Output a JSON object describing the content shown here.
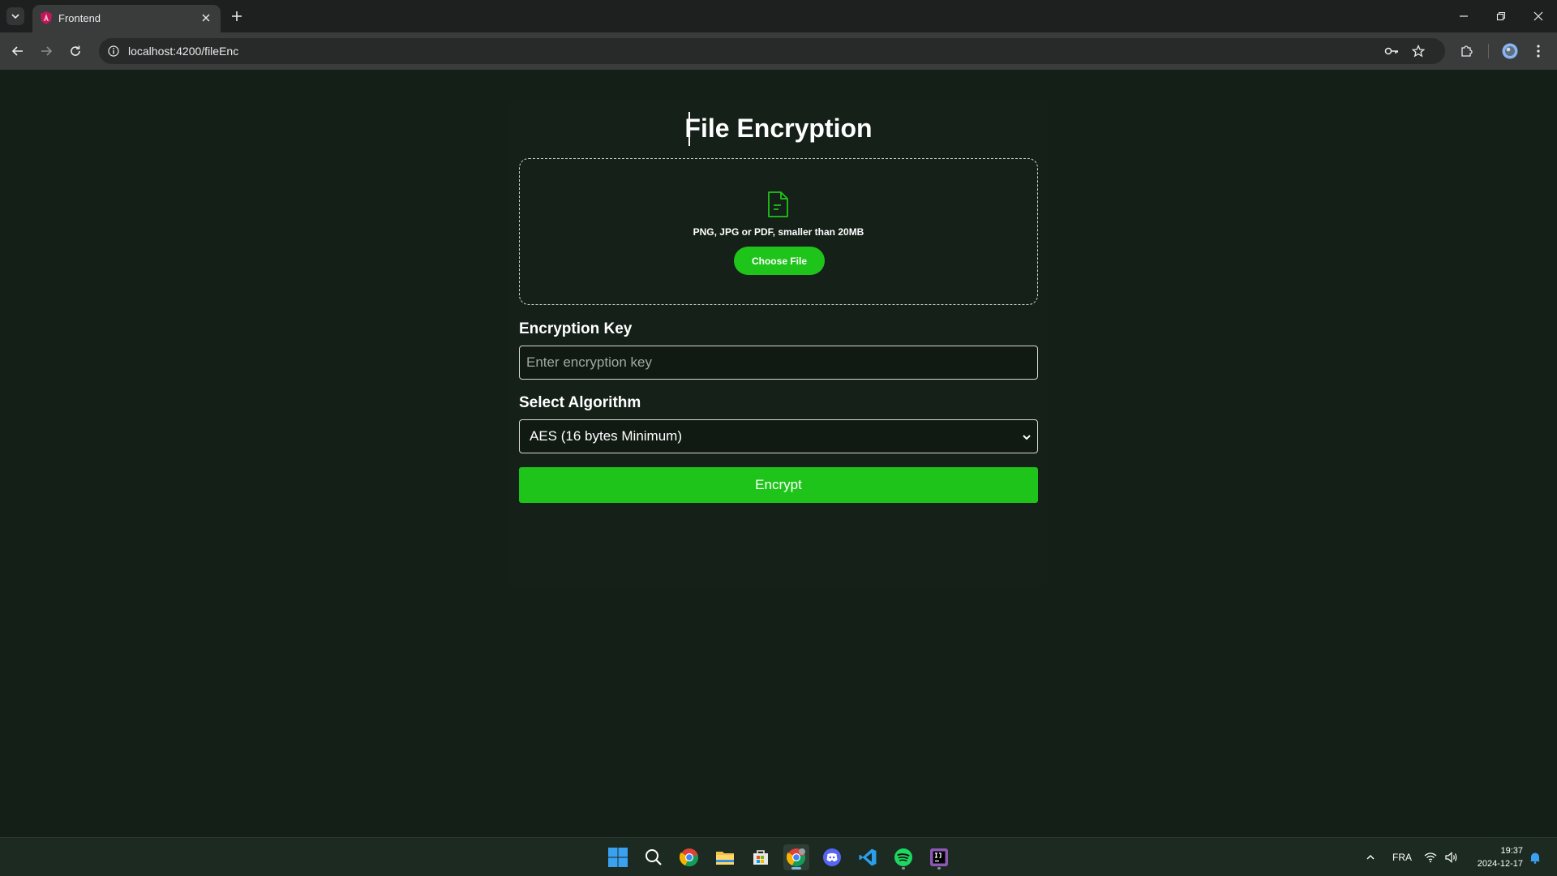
{
  "browser": {
    "tab_title": "Frontend",
    "url": "localhost:4200/fileEnc"
  },
  "page": {
    "title": "File Encryption",
    "dropzone": {
      "hint": "PNG, JPG or PDF, smaller than 20MB",
      "choose_label": "Choose File"
    },
    "key_field": {
      "label": "Encryption Key",
      "placeholder": "Enter encryption key",
      "value": ""
    },
    "algorithm_field": {
      "label": "Select Algorithm",
      "selected": "AES (16 bytes Minimum)"
    },
    "encrypt_label": "Encrypt",
    "accent_color": "#1fc41a"
  },
  "taskbar": {
    "apps": [
      "start-icon",
      "search-icon",
      "chrome-icon",
      "file-explorer-icon",
      "store-icon",
      "chrome-active-icon",
      "discord-icon",
      "vscode-icon",
      "spotify-icon",
      "intellij-icon"
    ],
    "language": "FRA",
    "time": "19:37",
    "date": "2024-12-17"
  }
}
